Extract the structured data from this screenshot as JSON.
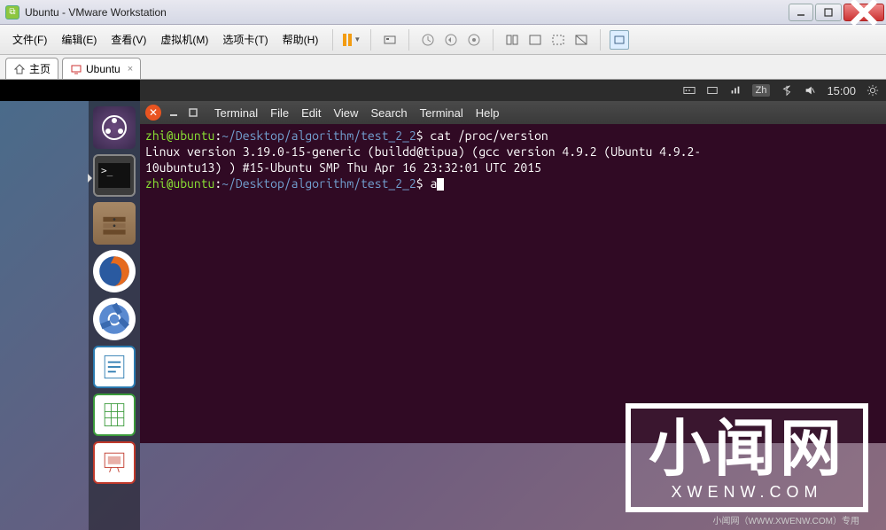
{
  "window": {
    "title": "Ubuntu - VMware Workstation"
  },
  "menubar": {
    "items": [
      "文件(F)",
      "编辑(E)",
      "查看(V)",
      "虚拟机(M)",
      "选项卡(T)",
      "帮助(H)"
    ]
  },
  "tabs": {
    "home": "主页",
    "vm": "Ubuntu"
  },
  "ubuntu_panel": {
    "ime": "Zh",
    "time": "15:00"
  },
  "terminal": {
    "menubar": [
      "Terminal",
      "File",
      "Edit",
      "View",
      "Search",
      "Terminal",
      "Help"
    ],
    "prompt_user": "zhi@ubuntu",
    "prompt_path": "~/Desktop/algorithm/test_2_2",
    "cmd1": "cat /proc/version",
    "output_line1": "Linux version 3.19.0-15-generic (buildd@tipua) (gcc version 4.9.2 (Ubuntu 4.9.2-",
    "output_line2": "10ubuntu13) ) #15-Ubuntu SMP Thu Apr 16 23:32:01 UTC 2015",
    "cmd2": "a"
  },
  "watermark": {
    "text": "小闻网",
    "url": "XWENW.COM",
    "sub": "小闻网（WWW.XWENW.COM）专用"
  }
}
